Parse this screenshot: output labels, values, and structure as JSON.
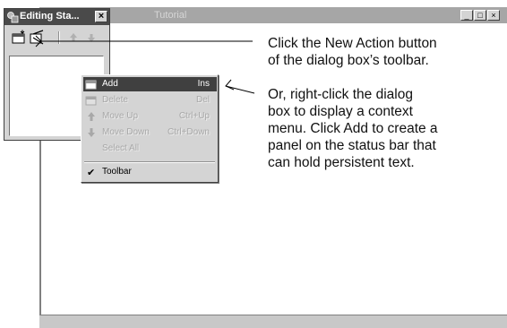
{
  "background_window": {
    "title": "Tutorial",
    "buttons": {
      "minimize": "_",
      "maximize": "□",
      "close": "×"
    }
  },
  "dialog": {
    "title": "Editing Sta...",
    "close_glyph": "×",
    "toolbar": {
      "new_action_icon": "new-action-icon",
      "delete_icon": "delete-icon",
      "move_up_icon": "arrow-up-icon",
      "move_down_icon": "arrow-down-icon"
    }
  },
  "context_menu": {
    "items": [
      {
        "label": "Add",
        "shortcut": "Ins",
        "state": "highlighted"
      },
      {
        "label": "Delete",
        "shortcut": "Del",
        "state": "disabled"
      },
      {
        "label": "Move Up",
        "shortcut": "Ctrl+Up",
        "state": "disabled"
      },
      {
        "label": "Move Down",
        "shortcut": "Ctrl+Down",
        "state": "disabled"
      },
      {
        "label": "Select All",
        "shortcut": "",
        "state": "disabled"
      },
      {
        "label": "Toolbar",
        "shortcut": "",
        "state": "checked"
      }
    ]
  },
  "callouts": {
    "first": [
      "Click the New Action button",
      "of the dialog box’s toolbar."
    ],
    "second": [
      "Or, right-click the dialog",
      "box to display a context",
      "menu. Click Add to create a",
      "panel on the status bar that",
      "can hold persistent text."
    ]
  }
}
